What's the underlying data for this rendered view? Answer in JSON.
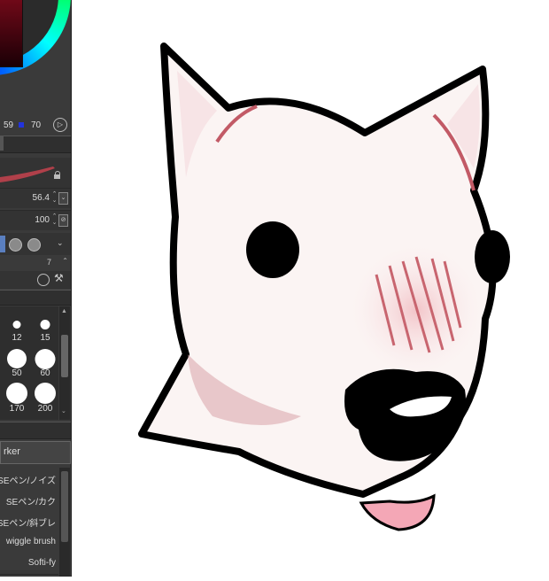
{
  "color": {
    "hsv_v1": "59",
    "hsv_v2": "70",
    "main_color": "#7a0a1a"
  },
  "properties": {
    "size_value": "56.4",
    "opacity_value": "100",
    "tiny_value": "7"
  },
  "brush_sizes": [
    "12",
    "15",
    "50",
    "60",
    "170",
    "200"
  ],
  "subtool_group": "rker",
  "brushes": [
    "SEペン/ノイズ",
    "SEペン/カク",
    "SEペン/斜ブレ",
    "wiggle brush",
    "Softi-fy"
  ]
}
